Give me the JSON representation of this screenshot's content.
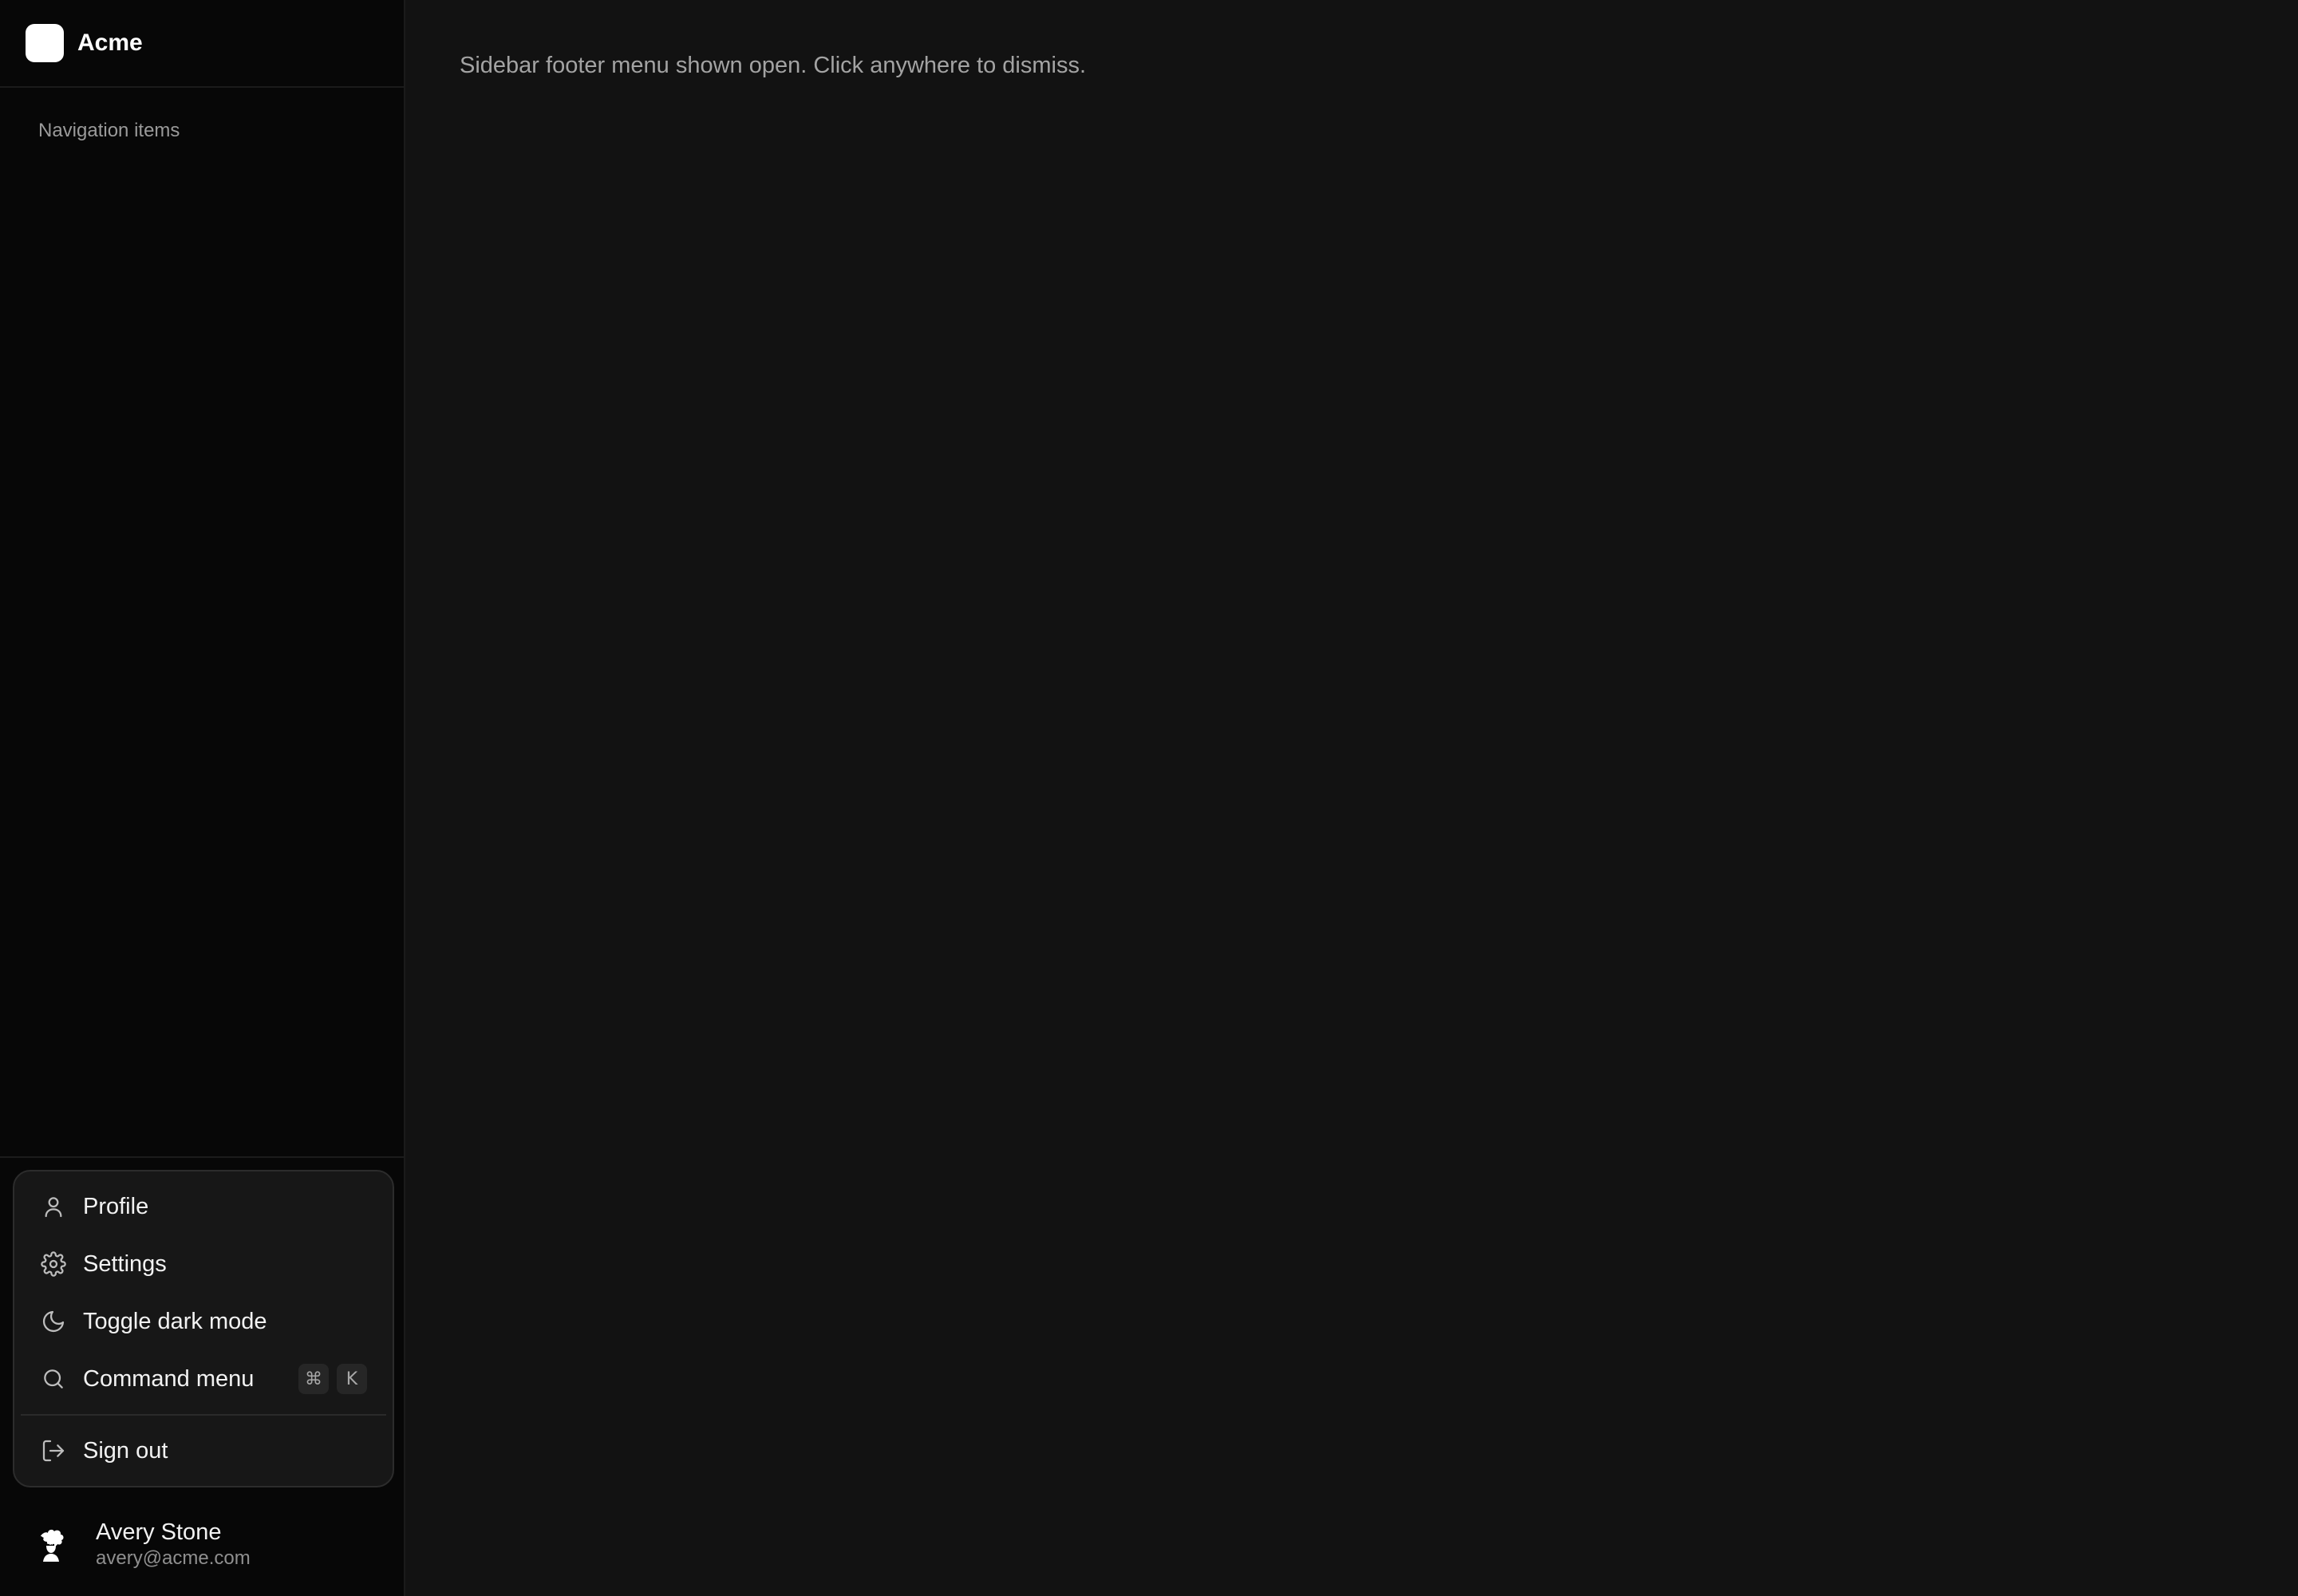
{
  "brand": {
    "name": "Acme"
  },
  "sidebar": {
    "nav_label": "Navigation items"
  },
  "menu": {
    "items": [
      {
        "label": "Profile",
        "icon": "user-icon"
      },
      {
        "label": "Settings",
        "icon": "gear-icon"
      },
      {
        "label": "Toggle dark mode",
        "icon": "moon-icon"
      },
      {
        "label": "Command menu",
        "icon": "search-icon",
        "shortcut": [
          "⌘",
          "K"
        ]
      },
      {
        "label": "Sign out",
        "icon": "sign-out-icon"
      }
    ]
  },
  "user": {
    "name": "Avery Stone",
    "email": "avery@acme.com"
  },
  "main": {
    "note": "Sidebar footer menu shown open. Click anywhere to dismiss."
  },
  "colors": {
    "background": "#121212",
    "sidebar": "#070707",
    "menu": "#171717",
    "text": "#f2f2f2",
    "muted": "#a3a3a3"
  }
}
